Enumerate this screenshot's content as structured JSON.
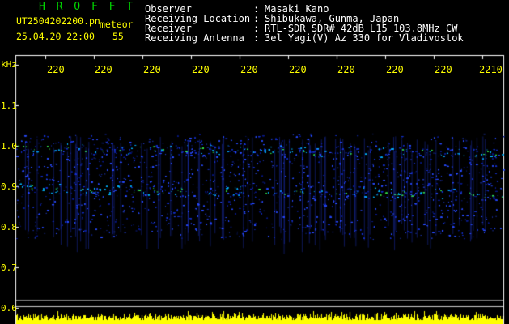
{
  "brand": "H R O F F T",
  "file": {
    "name": "UT2504202200.pn",
    "name_suffix": "meteor",
    "date": "25.04.20 22:00",
    "count": "55"
  },
  "header": [
    {
      "label": "Observer",
      "sep": ":",
      "value": "Masaki Kano"
    },
    {
      "label": "Receiving Location",
      "sep": ":",
      "value": "Shibukawa, Gunma, Japan"
    },
    {
      "label": "Receiver",
      "sep": ":",
      "value": "RTL-SDR SDR# 42dB L15 103.8MHz CW"
    },
    {
      "label": "Receiving Antenna",
      "sep": ":",
      "value": "3el Yagi(V) Az 330 for Vladivostok"
    }
  ],
  "y_axis": {
    "unit": "kHz",
    "ticks": [
      "1.1",
      "1.0",
      "0.9",
      "0.8",
      "0.7",
      "0.6"
    ]
  },
  "x_axis": {
    "ticks": [
      "220",
      "220",
      "220",
      "220",
      "220",
      "220",
      "220",
      "220",
      "220",
      "2210"
    ]
  },
  "colors": {
    "background": "#000000",
    "brand": "#00d800",
    "labels": "#ffff00",
    "header_text": "#ffffff",
    "echo_band": "#2a4cff",
    "echo_peak": "#34e04a",
    "intensity_bar": "#ffff00"
  }
}
